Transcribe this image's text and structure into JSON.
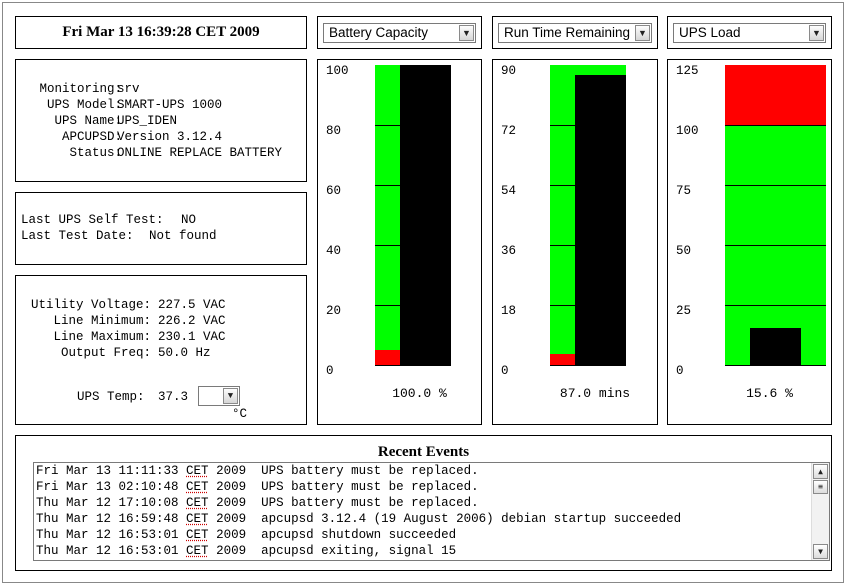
{
  "header": {
    "datetime": "Fri Mar 13 16:39:28 CET 2009"
  },
  "info": {
    "monitoring_label": "Monitoring:",
    "monitoring": "srv",
    "model_label": "UPS Model:",
    "model": "SMART-UPS 1000",
    "name_label": "UPS Name:",
    "name": "UPS_IDEN",
    "apcupsd_label": "APCUPSD:",
    "apcupsd": "Version 3.12.4",
    "status_label": "Status:",
    "status": "ONLINE REPLACE BATTERY"
  },
  "selftest": {
    "last_self_test_label": "Last UPS Self Test:",
    "last_self_test": "NO",
    "last_test_date_label": "Last Test Date:",
    "last_test_date": "Not found"
  },
  "power": {
    "utility_voltage_label": "Utility Voltage:",
    "utility_voltage": "227.5 VAC",
    "line_min_label": "Line Minimum:",
    "line_min": "226.2 VAC",
    "line_max_label": "Line Maximum:",
    "line_max": "230.1 VAC",
    "output_freq_label": "Output Freq:",
    "output_freq": "50.0 Hz",
    "temp_label": "UPS Temp:",
    "temp": "37.3",
    "temp_unit": "°C"
  },
  "gauges": [
    {
      "select": "Battery Capacity",
      "ticks": [
        "100",
        "80",
        "60",
        "40",
        "20",
        "0"
      ],
      "max": 100,
      "value": 100.0,
      "value_text": "100.0 %",
      "red_zone": "low",
      "red_fraction": 0.05
    },
    {
      "select": "Run Time Remaining",
      "ticks": [
        "90",
        "72",
        "54",
        "36",
        "18",
        "0"
      ],
      "max": 90,
      "value": 87.0,
      "value_text": "87.0 mins",
      "red_zone": "low",
      "red_fraction": 0.035
    },
    {
      "select": "UPS Load",
      "ticks": [
        "125",
        "100",
        "75",
        "50",
        "25",
        "0"
      ],
      "max": 125,
      "value": 15.6,
      "value_text": "15.6 %",
      "red_zone": "high",
      "red_fraction": 0.2
    }
  ],
  "colors": {
    "ok": "#00ff00",
    "alarm": "#ff0000",
    "needle": "#000000"
  },
  "events": {
    "title": "Recent Events",
    "rows": [
      {
        "date": "Fri Mar 13 11:11:33",
        "tz": "CET",
        "year": "2009",
        "msg": "UPS battery must be replaced."
      },
      {
        "date": "Fri Mar 13 02:10:48",
        "tz": "CET",
        "year": "2009",
        "msg": "UPS battery must be replaced."
      },
      {
        "date": "Thu Mar 12 17:10:08",
        "tz": "CET",
        "year": "2009",
        "msg": "UPS battery must be replaced."
      },
      {
        "date": "Thu Mar 12 16:59:48",
        "tz": "CET",
        "year": "2009",
        "msg": "apcupsd 3.12.4 (19 August 2006) debian startup succeeded"
      },
      {
        "date": "Thu Mar 12 16:53:01",
        "tz": "CET",
        "year": "2009",
        "msg": "apcupsd shutdown succeeded"
      },
      {
        "date": "Thu Mar 12 16:53:01",
        "tz": "CET",
        "year": "2009",
        "msg": "apcupsd exiting, signal 15"
      }
    ]
  }
}
